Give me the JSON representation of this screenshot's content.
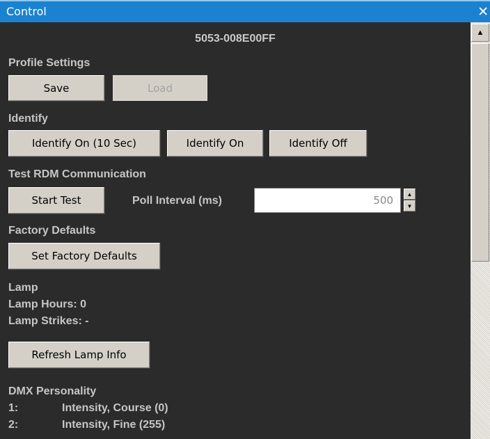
{
  "window": {
    "title": "Control",
    "close_glyph": "✕"
  },
  "device_id": "5053-008E00FF",
  "profile": {
    "heading": "Profile Settings",
    "save_label": "Save",
    "load_label": "Load"
  },
  "identify": {
    "heading": "Identify",
    "on_10_label": "Identify On (10 Sec)",
    "on_label": "Identify On",
    "off_label": "Identify Off"
  },
  "test_rdm": {
    "heading": "Test RDM Communication",
    "start_label": "Start Test",
    "poll_label": "Poll Interval (ms)",
    "poll_value": "500"
  },
  "factory": {
    "heading": "Factory Defaults",
    "set_label": "Set Factory Defaults"
  },
  "lamp": {
    "heading": "Lamp",
    "hours": "Lamp Hours: 0",
    "strikes": "Lamp Strikes: -",
    "refresh_label": "Refresh Lamp Info"
  },
  "dmx": {
    "heading": "DMX Personality",
    "items": [
      {
        "num": "1:",
        "name": "Intensity, Course (0)"
      },
      {
        "num": "2:",
        "name": "Intensity, Fine (255)"
      }
    ]
  },
  "scrollbar": {
    "up_icon": "up-arrow-icon"
  }
}
